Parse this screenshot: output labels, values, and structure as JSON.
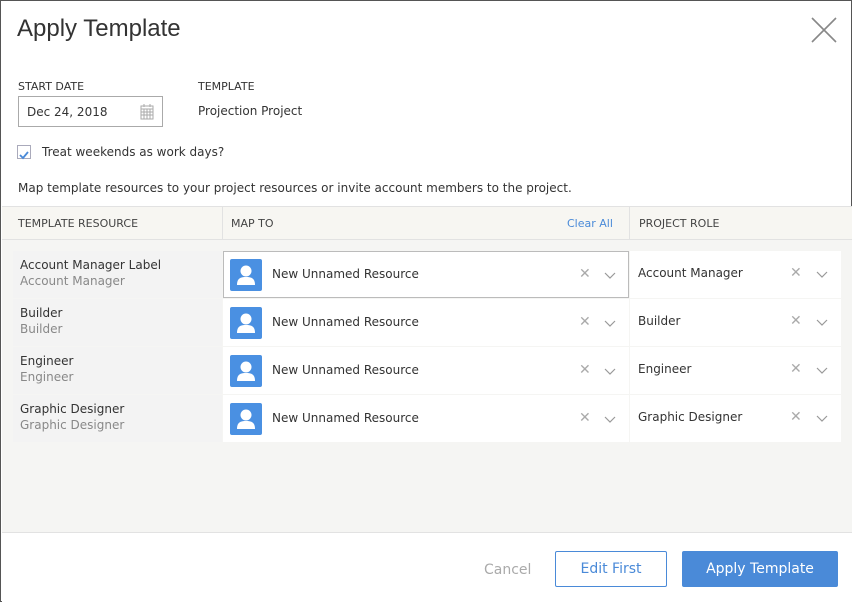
{
  "dialog": {
    "title": "Apply Template"
  },
  "form": {
    "start_date_label": "START DATE",
    "start_date_value": "Dec 24, 2018",
    "template_label": "TEMPLATE",
    "template_value": "Projection Project",
    "weekends_label": "Treat weekends as work days?",
    "weekends_checked": true,
    "info": "Map template resources to your project resources or invite account members to the project."
  },
  "table": {
    "headers": {
      "resource": "TEMPLATE RESOURCE",
      "map_to": "MAP TO",
      "clear_all": "Clear All",
      "role": "PROJECT ROLE"
    },
    "rows": [
      {
        "name": "Account Manager Label",
        "sub": "Account Manager",
        "map": "New Unnamed Resource",
        "role": "Account Manager"
      },
      {
        "name": "Builder",
        "sub": "Builder",
        "map": "New Unnamed Resource",
        "role": "Builder"
      },
      {
        "name": "Engineer",
        "sub": "Engineer",
        "map": "New Unnamed Resource",
        "role": "Engineer"
      },
      {
        "name": "Graphic Designer",
        "sub": "Graphic Designer",
        "map": "New Unnamed Resource",
        "role": "Graphic Designer"
      }
    ]
  },
  "footer": {
    "cancel": "Cancel",
    "edit_first": "Edit First",
    "apply": "Apply Template"
  },
  "colors": {
    "accent": "#4a8ad8",
    "avatar": "#4a90e2"
  }
}
